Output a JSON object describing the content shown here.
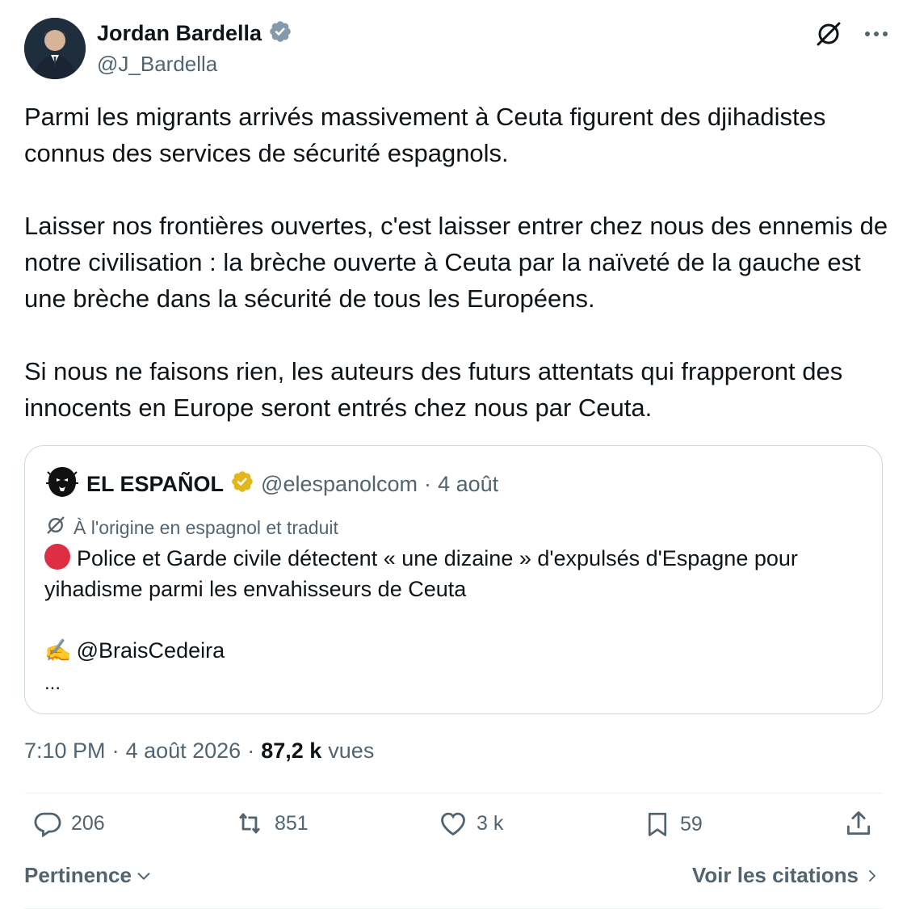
{
  "author": {
    "name": "Jordan Bardella",
    "handle": "@J_Bardella",
    "avatar_icon": "avatar-photo"
  },
  "header_actions": {
    "translate_icon": "translate-icon",
    "more_icon": "more-icon"
  },
  "tweet": {
    "text": "Parmi les migrants arrivés massivement à Ceuta figurent des djihadistes connus des services de sécurité espagnols.\n\nLaisser nos frontières ouvertes, c'est laisser entrer chez nous des ennemis de notre civilisation : la brèche ouverte à Ceuta par la naïveté de la gauche est une brèche dans la sécurité de tous les Européens.\n\nSi nous ne faisons rien, les auteurs des futurs attentats qui frapperont des innocents en Europe seront entrés chez nous par Ceuta."
  },
  "quote": {
    "name": "EL ESPAÑOL",
    "handle": "@elespanolcom",
    "separator": "·",
    "date": "4 août",
    "translated_label": "À l'origine en espagnol et traduit",
    "body_line1": "Police et Garde civile détectent « une dizaine » d'expulsés d'Espagne pour yihadisme parmi les envahisseurs de Ceuta",
    "body_line2": "@BraisCedeira",
    "pen_emoji": "✍️",
    "ellipsis": "..."
  },
  "meta": {
    "time": "7:10 PM",
    "dot1": "·",
    "date": "4 août 2026",
    "dot2": "·",
    "views": "87,2 k",
    "views_label": "vues"
  },
  "actions": {
    "replies": "206",
    "reposts": "851",
    "likes": "3 k",
    "bookmarks": "59"
  },
  "footer": {
    "sort_label": "Pertinence",
    "quotes_label": "Voir les citations"
  },
  "colors": {
    "text": "#0f1419",
    "secondary": "#536471",
    "verified_blue": "#829aab",
    "verified_gold": "#e2b719",
    "border": "#cfd9de"
  }
}
